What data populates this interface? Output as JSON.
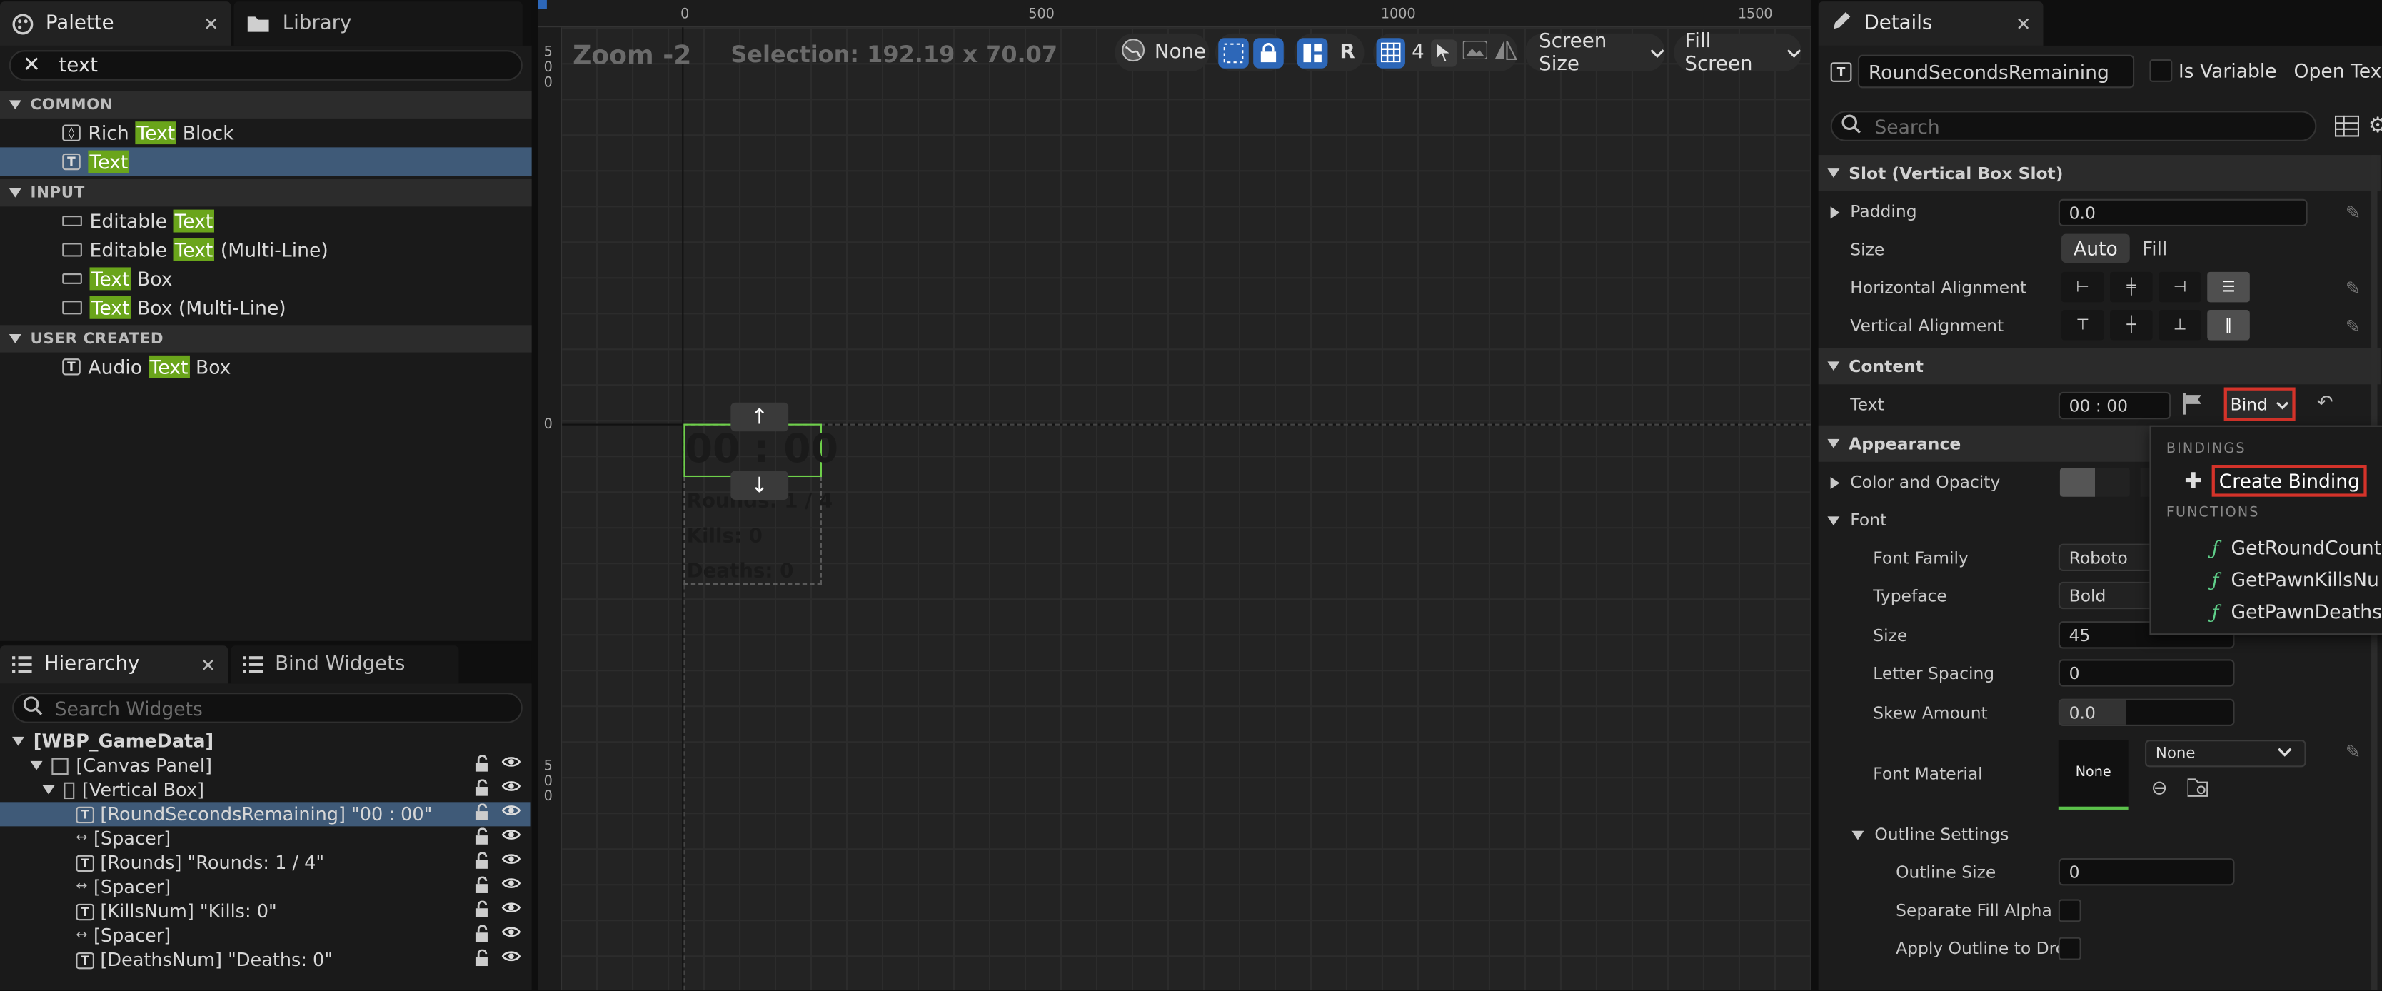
{
  "palette": {
    "tab_label": "Palette",
    "library_tab_label": "Library",
    "search_value": "text",
    "categories": [
      {
        "name": "COMMON",
        "items": [
          {
            "pre": "Rich ",
            "hl": "Text",
            "post": " Block"
          },
          {
            "pre": "",
            "hl": "Text",
            "post": ""
          }
        ]
      },
      {
        "name": "INPUT",
        "items": [
          {
            "pre": "Editable ",
            "hl": "Text",
            "post": ""
          },
          {
            "pre": "Editable ",
            "hl": "Text",
            "post": " (Multi-Line)"
          },
          {
            "pre": "",
            "hl": "Text",
            "post": " Box"
          },
          {
            "pre": "",
            "hl": "Text",
            "post": " Box (Multi-Line)"
          }
        ]
      },
      {
        "name": "USER CREATED",
        "items": [
          {
            "pre": "Audio ",
            "hl": "Text",
            "post": " Box"
          }
        ]
      }
    ]
  },
  "hierarchy": {
    "tab_label": "Hierarchy",
    "bind_tab_label": "Bind Widgets",
    "search_placeholder": "Search Widgets",
    "rows": [
      "[WBP_GameData]",
      "[Canvas Panel]",
      "[Vertical Box]",
      "[RoundSecondsRemaining] \"00 : 00\"",
      "[Spacer]",
      "[Rounds] \"Rounds: 1 / 4\"",
      "[Spacer]",
      "[KillsNum] \"Kills: 0\"",
      "[Spacer]",
      "[DeathsNum] \"Deaths: 0\""
    ]
  },
  "viewport": {
    "zoom": "Zoom -2",
    "selection": "Selection: 192.19 x 70.07",
    "ruler_labels": [
      "0",
      "500",
      "1000",
      "1500"
    ],
    "left_ruler_top": "5\n0\n0",
    "left_ruler_zero": "0",
    "left_ruler_bottom": "5\n0\n0",
    "toolbar": {
      "none_label": "None",
      "r_label": "R",
      "grid_num": "4",
      "screen_size": "Screen Size",
      "fill_screen": "Fill Screen"
    },
    "widget": {
      "time": "00 : 00",
      "rounds": "Rounds: 1 / 4",
      "kills": "Kills: 0",
      "deaths": "Deaths: 0"
    }
  },
  "details": {
    "tab_label": "Details",
    "widget_name": "RoundSecondsRemaining",
    "is_variable_label": "Is Variable",
    "open_text": "Open Text",
    "search_placeholder": "Search",
    "slot_section": "Slot (Vertical Box Slot)",
    "padding_label": "Padding",
    "padding_value": "0.0",
    "size_label": "Size",
    "size_auto": "Auto",
    "size_fill": "Fill",
    "halign_label": "Horizontal Alignment",
    "valign_label": "Vertical Alignment",
    "content_section": "Content",
    "text_label": "Text",
    "text_value": "00 : 00",
    "bind_label": "Bind",
    "appearance_section": "Appearance",
    "color_label": "Color and Opacity",
    "font_label": "Font",
    "font_family_label": "Font Family",
    "font_family_value": "Roboto",
    "typeface_label": "Typeface",
    "typeface_value": "Bold",
    "size2_label": "Size",
    "size2_value": "45",
    "letter_spacing_label": "Letter Spacing",
    "letter_spacing_value": "0",
    "skew_label": "Skew Amount",
    "skew_value": "0.0",
    "font_material_label": "Font Material",
    "font_material_thumb": "None",
    "font_material_value": "None",
    "outline_label": "Outline Settings",
    "outline_size_label": "Outline Size",
    "outline_size_value": "0",
    "separate_fill_label": "Separate Fill Alpha",
    "apply_outline_label": "Apply Outline to Dro..."
  },
  "bind_dropdown": {
    "bindings_header": "BINDINGS",
    "create_binding": "Create Binding",
    "functions_header": "FUNCTIONS",
    "functions": [
      "GetRoundCountI",
      "GetPawnKillsNu",
      "GetPawnDeaths"
    ]
  },
  "colors": {
    "accent_green": "#6aa51b",
    "selection_blue": "#3f5a78",
    "highlight_red": "#d4332a",
    "toolbar_blue": "#2d67b8"
  }
}
